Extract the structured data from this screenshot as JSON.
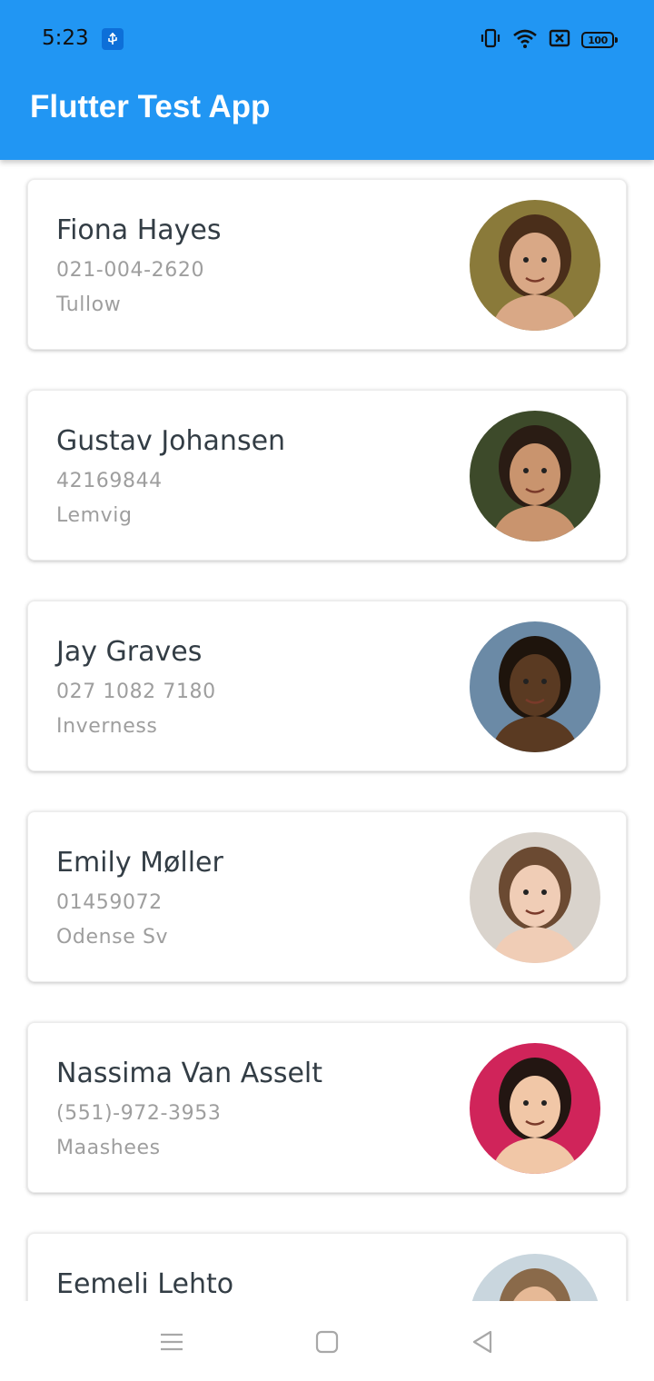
{
  "status_bar": {
    "time": "5:23",
    "battery": "100",
    "icons": [
      "usb-icon",
      "vibrate-icon",
      "wifi-icon",
      "battery-saver-icon",
      "battery-icon"
    ]
  },
  "app_bar": {
    "title": "Flutter Test App",
    "color": "#2196f3"
  },
  "contacts": [
    {
      "name": "Fiona Hayes",
      "phone": "021-004-2620",
      "city": "Tullow",
      "avatar_bg": "#8a7a3a",
      "avatar_skin": "#d9a886",
      "avatar_hair": "#4a2e1a"
    },
    {
      "name": "Gustav Johansen",
      "phone": "42169844",
      "city": "Lemvig",
      "avatar_bg": "#3d4a2a",
      "avatar_skin": "#c9946e",
      "avatar_hair": "#2a1c14"
    },
    {
      "name": "Jay Graves",
      "phone": "027 1082 7180",
      "city": "Inverness",
      "avatar_bg": "#6b8aa6",
      "avatar_skin": "#5a3a22",
      "avatar_hair": "#1e140c"
    },
    {
      "name": "Emily Møller",
      "phone": "01459072",
      "city": "Odense Sv",
      "avatar_bg": "#d9d3cc",
      "avatar_skin": "#f0cdb6",
      "avatar_hair": "#6b4a32"
    },
    {
      "name": "Nassima Van Asselt",
      "phone": "(551)-972-3953",
      "city": "Maashees",
      "avatar_bg": "#d0245a",
      "avatar_skin": "#f1c7a7",
      "avatar_hair": "#231612"
    },
    {
      "name": "Eemeli Lehto",
      "phone": "",
      "city": "",
      "avatar_bg": "#c9d6de",
      "avatar_skin": "#e6b996",
      "avatar_hair": "#8a6a4a"
    }
  ],
  "nav_bar": {
    "icons": [
      "menu-icon",
      "home-icon",
      "back-icon"
    ]
  }
}
